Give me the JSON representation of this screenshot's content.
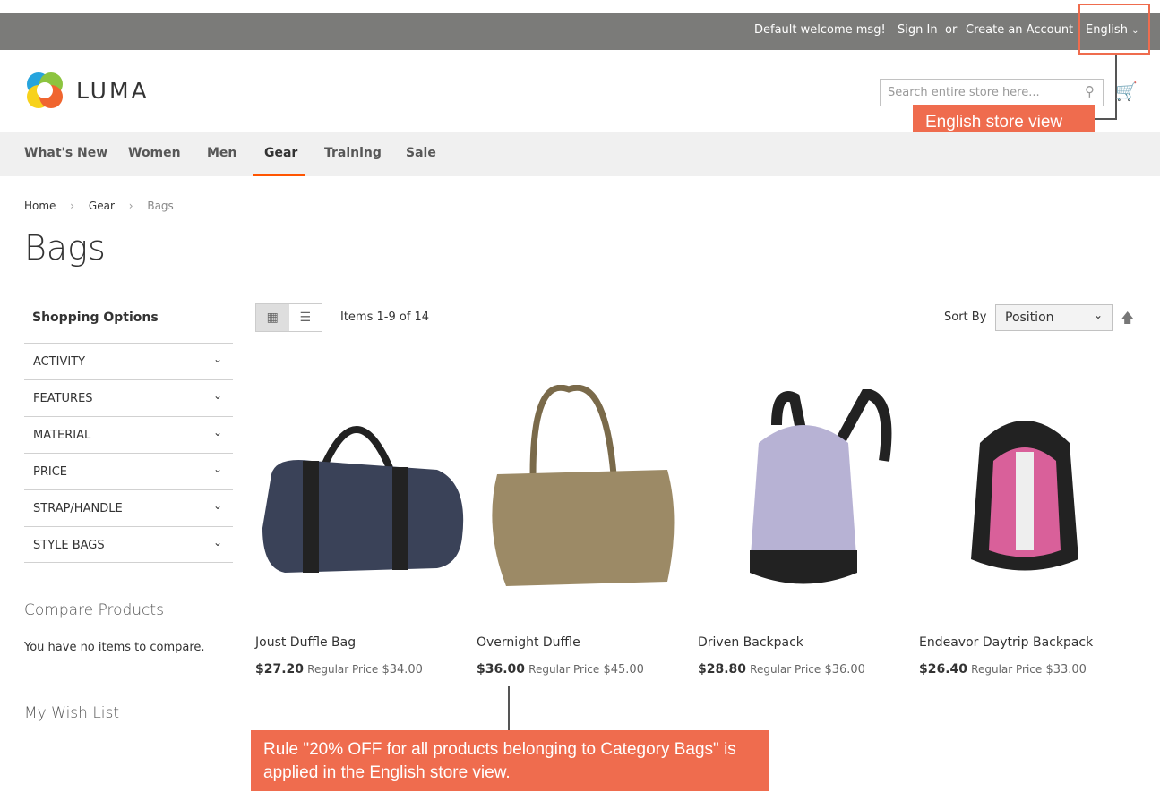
{
  "header": {
    "welcome": "Default welcome msg!",
    "sign_in": "Sign In",
    "or": "or",
    "create_account": "Create an Account",
    "language": "English",
    "logo": "LUMA",
    "search_placeholder": "Search entire store here..."
  },
  "nav": [
    "What's New",
    "Women",
    "Men",
    "Gear",
    "Training",
    "Sale"
  ],
  "breadcrumb": [
    "Home",
    "Gear",
    "Bags"
  ],
  "page_title": "Bags",
  "sidebar": {
    "title": "Shopping Options",
    "filters": [
      "ACTIVITY",
      "FEATURES",
      "MATERIAL",
      "PRICE",
      "STRAP/HANDLE",
      "STYLE BAGS"
    ],
    "compare_title": "Compare Products",
    "compare_text": "You have no items to compare.",
    "wishlist_title": "My Wish List"
  },
  "toolbar": {
    "items": "Items 1-9 of 14",
    "sort_label": "Sort By",
    "sort_value": "Position"
  },
  "products": [
    {
      "name": "Joust Duffle Bag",
      "price": "$27.20",
      "regular_label": "Regular Price",
      "regular": "$34.00",
      "color": "#3a4258"
    },
    {
      "name": "Overnight Duffle",
      "price": "$36.00",
      "regular_label": "Regular Price",
      "regular": "$45.00",
      "color": "#9c8a66"
    },
    {
      "name": "Driven Backpack",
      "price": "$28.80",
      "regular_label": "Regular Price",
      "regular": "$36.00",
      "color": "#b7b2d4"
    },
    {
      "name": "Endeavor Daytrip Backpack",
      "price": "$26.40",
      "regular_label": "Regular Price",
      "regular": "$33.00",
      "color": "#d9609a"
    }
  ],
  "annotations": {
    "store_view": "English store view",
    "rule": "Rule \"20% OFF for all products belonging to Category Bags\" is applied in the English store view.",
    "accent": "#ef6c4e"
  }
}
